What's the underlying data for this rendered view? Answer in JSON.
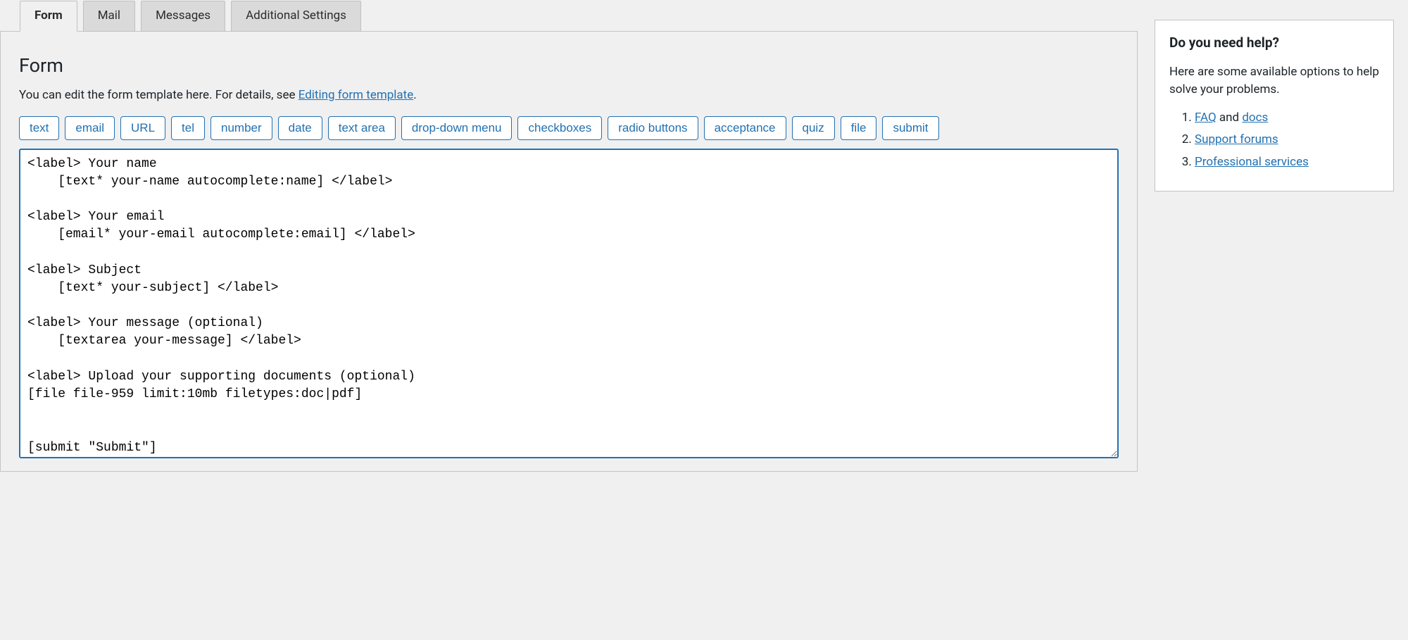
{
  "tabs": [
    {
      "label": "Form",
      "active": true
    },
    {
      "label": "Mail",
      "active": false
    },
    {
      "label": "Messages",
      "active": false
    },
    {
      "label": "Additional Settings",
      "active": false
    }
  ],
  "section": {
    "title": "Form",
    "desc_pre": "You can edit the form template here. For details, see ",
    "desc_link": "Editing form template",
    "desc_post": "."
  },
  "tag_buttons": [
    "text",
    "email",
    "URL",
    "tel",
    "number",
    "date",
    "text area",
    "drop-down menu",
    "checkboxes",
    "radio buttons",
    "acceptance",
    "quiz",
    "file",
    "submit"
  ],
  "form_template": "<label> Your name\n    [text* your-name autocomplete:name] </label>\n\n<label> Your email\n    [email* your-email autocomplete:email] </label>\n\n<label> Subject\n    [text* your-subject] </label>\n\n<label> Your message (optional)\n    [textarea your-message] </label>\n\n<label> Upload your supporting documents (optional)\n[file file-959 limit:10mb filetypes:doc|pdf]\n\n\n[submit \"Submit\"]",
  "help": {
    "title": "Do you need help?",
    "intro": "Here are some available options to help solve your problems.",
    "items": [
      {
        "link": "FAQ",
        "suffix": " and ",
        "link2": "docs"
      },
      {
        "link": "Support forums"
      },
      {
        "link": "Professional services"
      }
    ]
  }
}
